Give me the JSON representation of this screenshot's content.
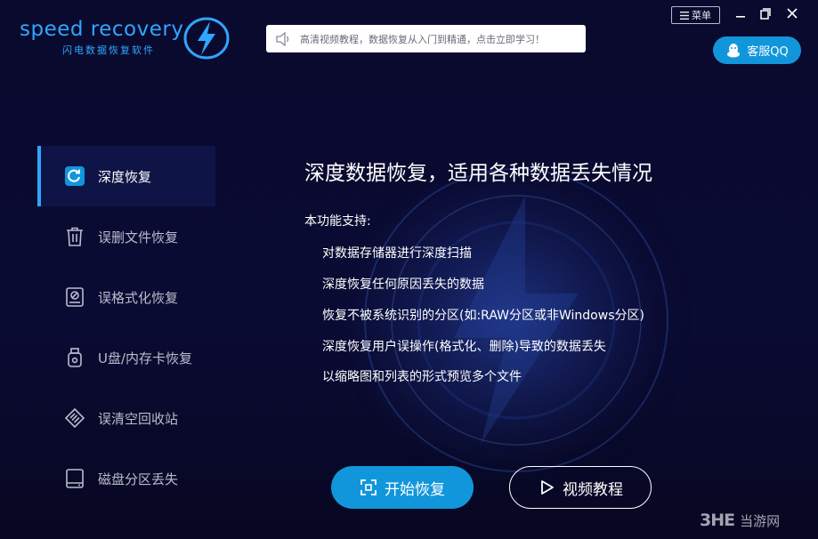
{
  "app": {
    "brand_name": "speed recovery",
    "brand_sub": "闪电数据恢复软件"
  },
  "header": {
    "notice_text": "高清视频教程，数据恢复从入门到精通，点击立即学习！",
    "menu_label": "菜单",
    "support_label": "客服QQ"
  },
  "sidebar": {
    "items": [
      {
        "label": "深度恢复",
        "icon": "deep-recovery-icon",
        "active": true
      },
      {
        "label": "误删文件恢复",
        "icon": "trash-icon",
        "active": false
      },
      {
        "label": "误格式化恢复",
        "icon": "format-disk-icon",
        "active": false
      },
      {
        "label": "U盘/内存卡恢复",
        "icon": "usb-icon",
        "active": false
      },
      {
        "label": "误清空回收站",
        "icon": "recycle-bin-icon",
        "active": false
      },
      {
        "label": "磁盘分区丢失",
        "icon": "disk-partition-icon",
        "active": false
      }
    ]
  },
  "main": {
    "title": "深度数据恢复，适用各种数据丢失情况",
    "support_heading": "本功能支持:",
    "features": [
      "对数据存储器进行深度扫描",
      "深度恢复任何原因丢失的数据",
      "恢复不被系统识别的分区(如:RAW分区或非Windows分区)",
      "深度恢复用户误操作(格式化、删除)导致的数据丢失",
      "以缩略图和列表的形式预览多个文件"
    ],
    "start_button": "开始恢复",
    "video_button": "视频教程"
  },
  "watermark": {
    "mark": "3HE",
    "text": "当游网"
  },
  "colors": {
    "background": "#0b0a2a",
    "accent": "#1296db",
    "brand_blue": "#2fa6ff",
    "sidebar_active": "#0f1446"
  }
}
